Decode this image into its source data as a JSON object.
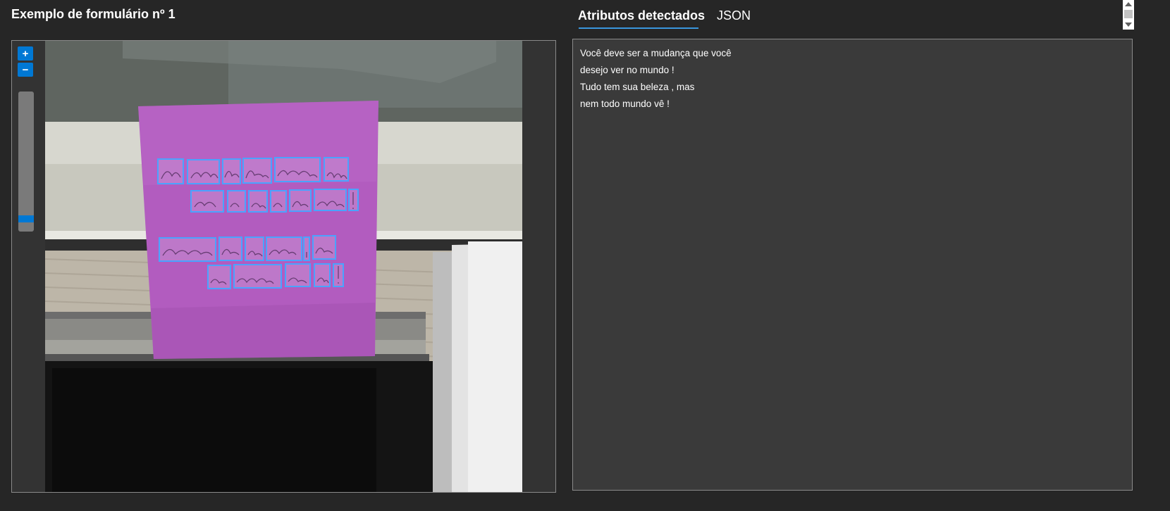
{
  "left_panel": {
    "title": "Exemplo de formulário nº 1",
    "zoom_in_label": "+",
    "zoom_out_label": "−"
  },
  "tabs": [
    {
      "label": "Atributos detectados",
      "active": true
    },
    {
      "label": "JSON",
      "active": false
    }
  ],
  "results": {
    "lines": [
      "Você deve ser a mudança que você",
      "desejo ver no mundo !",
      "Tudo tem sua beleza , mas",
      "nem todo mundo vê !"
    ]
  },
  "image": {
    "handwritten_lines": [
      [
        "You",
        "must",
        "be",
        "the",
        "change",
        "you"
      ],
      [
        "wish",
        "to",
        "see",
        "in",
        "the",
        "world",
        "!"
      ],
      [
        "Everything",
        "has",
        "its",
        "beauty",
        ",",
        "but"
      ],
      [
        "not",
        "everyone",
        "sees",
        "it",
        "!"
      ]
    ]
  },
  "colors": {
    "accent": "#0078d4",
    "tab_underline": "#3a96dd",
    "word_box": "#4aa3ff",
    "sticky_note": "#b25cbf"
  }
}
